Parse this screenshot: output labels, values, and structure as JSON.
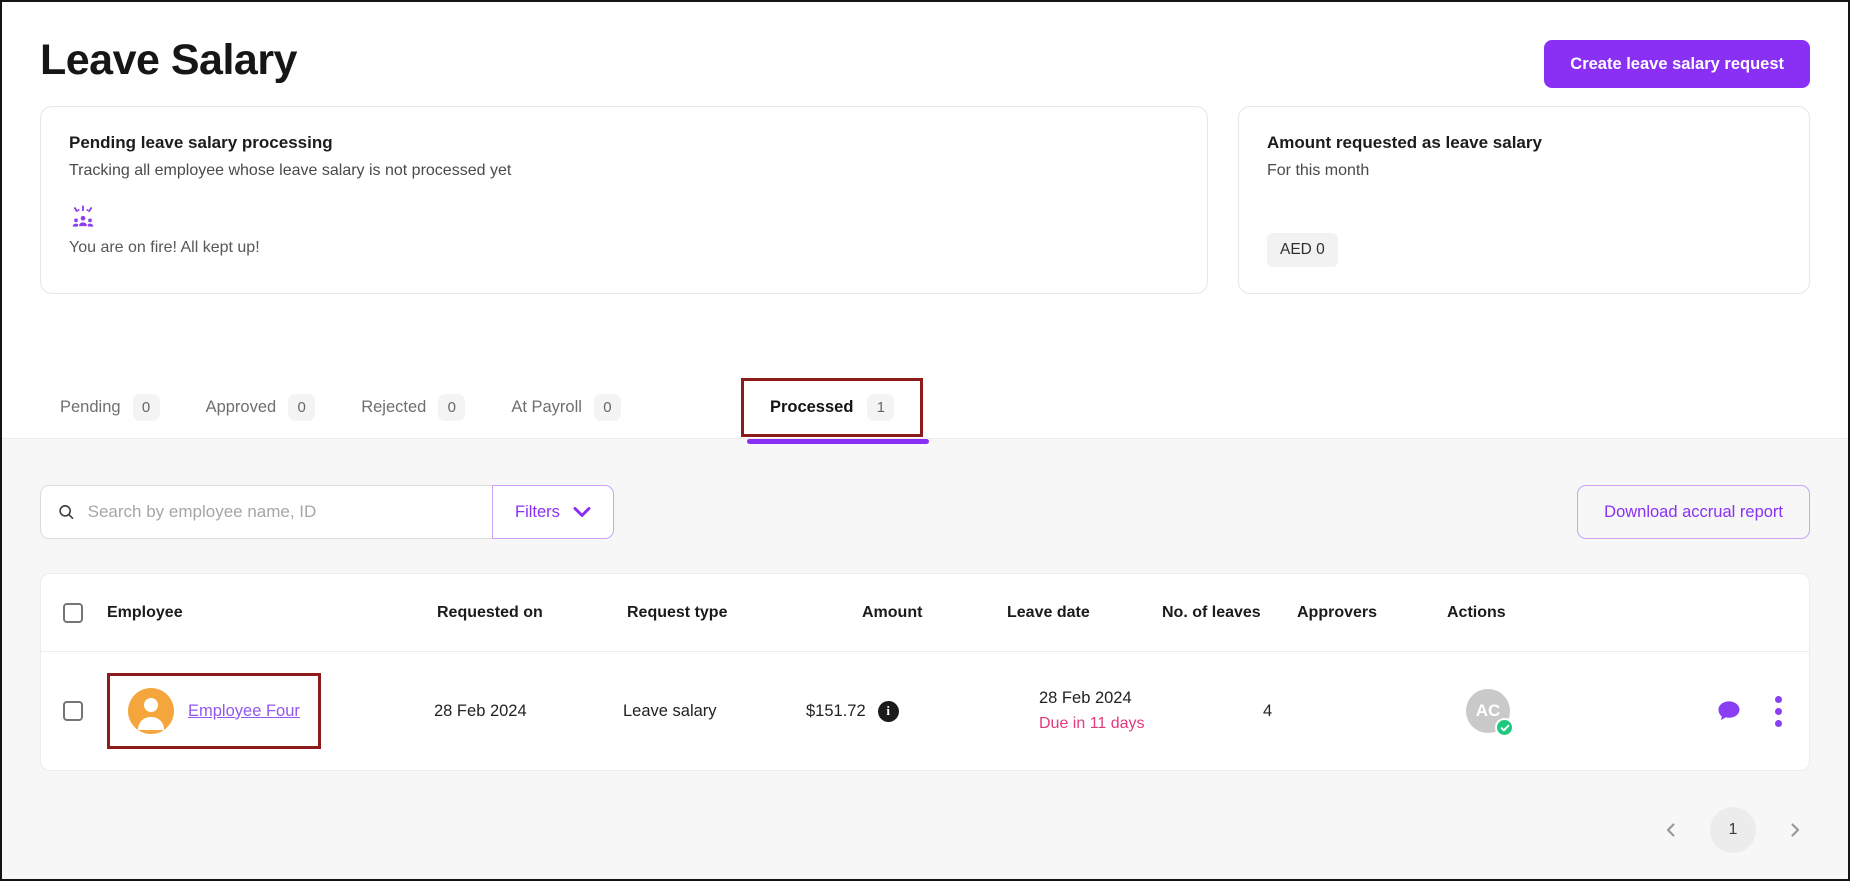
{
  "header": {
    "title": "Leave Salary",
    "create_button_label": "Create leave salary request"
  },
  "cards": {
    "pending_processing": {
      "title": "Pending leave salary processing",
      "subtitle": "Tracking all employee whose leave salary is not processed yet",
      "icon": "celebration-people-icon",
      "status_message": "You are on fire! All kept up!"
    },
    "amount_requested": {
      "title": "Amount requested as leave salary",
      "subtitle": "For this month",
      "amount_chip": "AED 0"
    }
  },
  "tabs": [
    {
      "label": "Pending",
      "count": "0",
      "active": false
    },
    {
      "label": "Approved",
      "count": "0",
      "active": false
    },
    {
      "label": "Rejected",
      "count": "0",
      "active": false
    },
    {
      "label": "At Payroll",
      "count": "0",
      "active": false
    },
    {
      "label": "Processed",
      "count": "1",
      "active": true,
      "annotated": true
    }
  ],
  "toolbar": {
    "search_placeholder": "Search by employee name, ID",
    "filters_label": "Filters",
    "download_button_label": "Download accrual report"
  },
  "table": {
    "columns": [
      "Employee",
      "Requested on",
      "Request type",
      "Amount",
      "Leave date",
      "No. of leaves",
      "Approvers",
      "Actions"
    ],
    "rows": [
      {
        "employee_name": "Employee Four",
        "avatar": "person-illustration-orange",
        "requested_on": "28 Feb 2024",
        "request_type": "Leave salary",
        "amount": "$151.72",
        "leave_date": "28 Feb 2024",
        "due_label": "Due in 11 days",
        "leaves_count": "4",
        "approver_initials": "AC",
        "approver_status": "approved"
      }
    ]
  },
  "pagination": {
    "current_page": "1"
  },
  "colors": {
    "accent_purple": "#8A30F4",
    "light_purple_border": "#C9A4F6",
    "annotation_red": "#8E1B1B",
    "due_pink": "#E23A7B",
    "avatar_orange": "#F4A63C",
    "approved_green": "#1EC97E",
    "section_gray": "#F7F7F7"
  }
}
